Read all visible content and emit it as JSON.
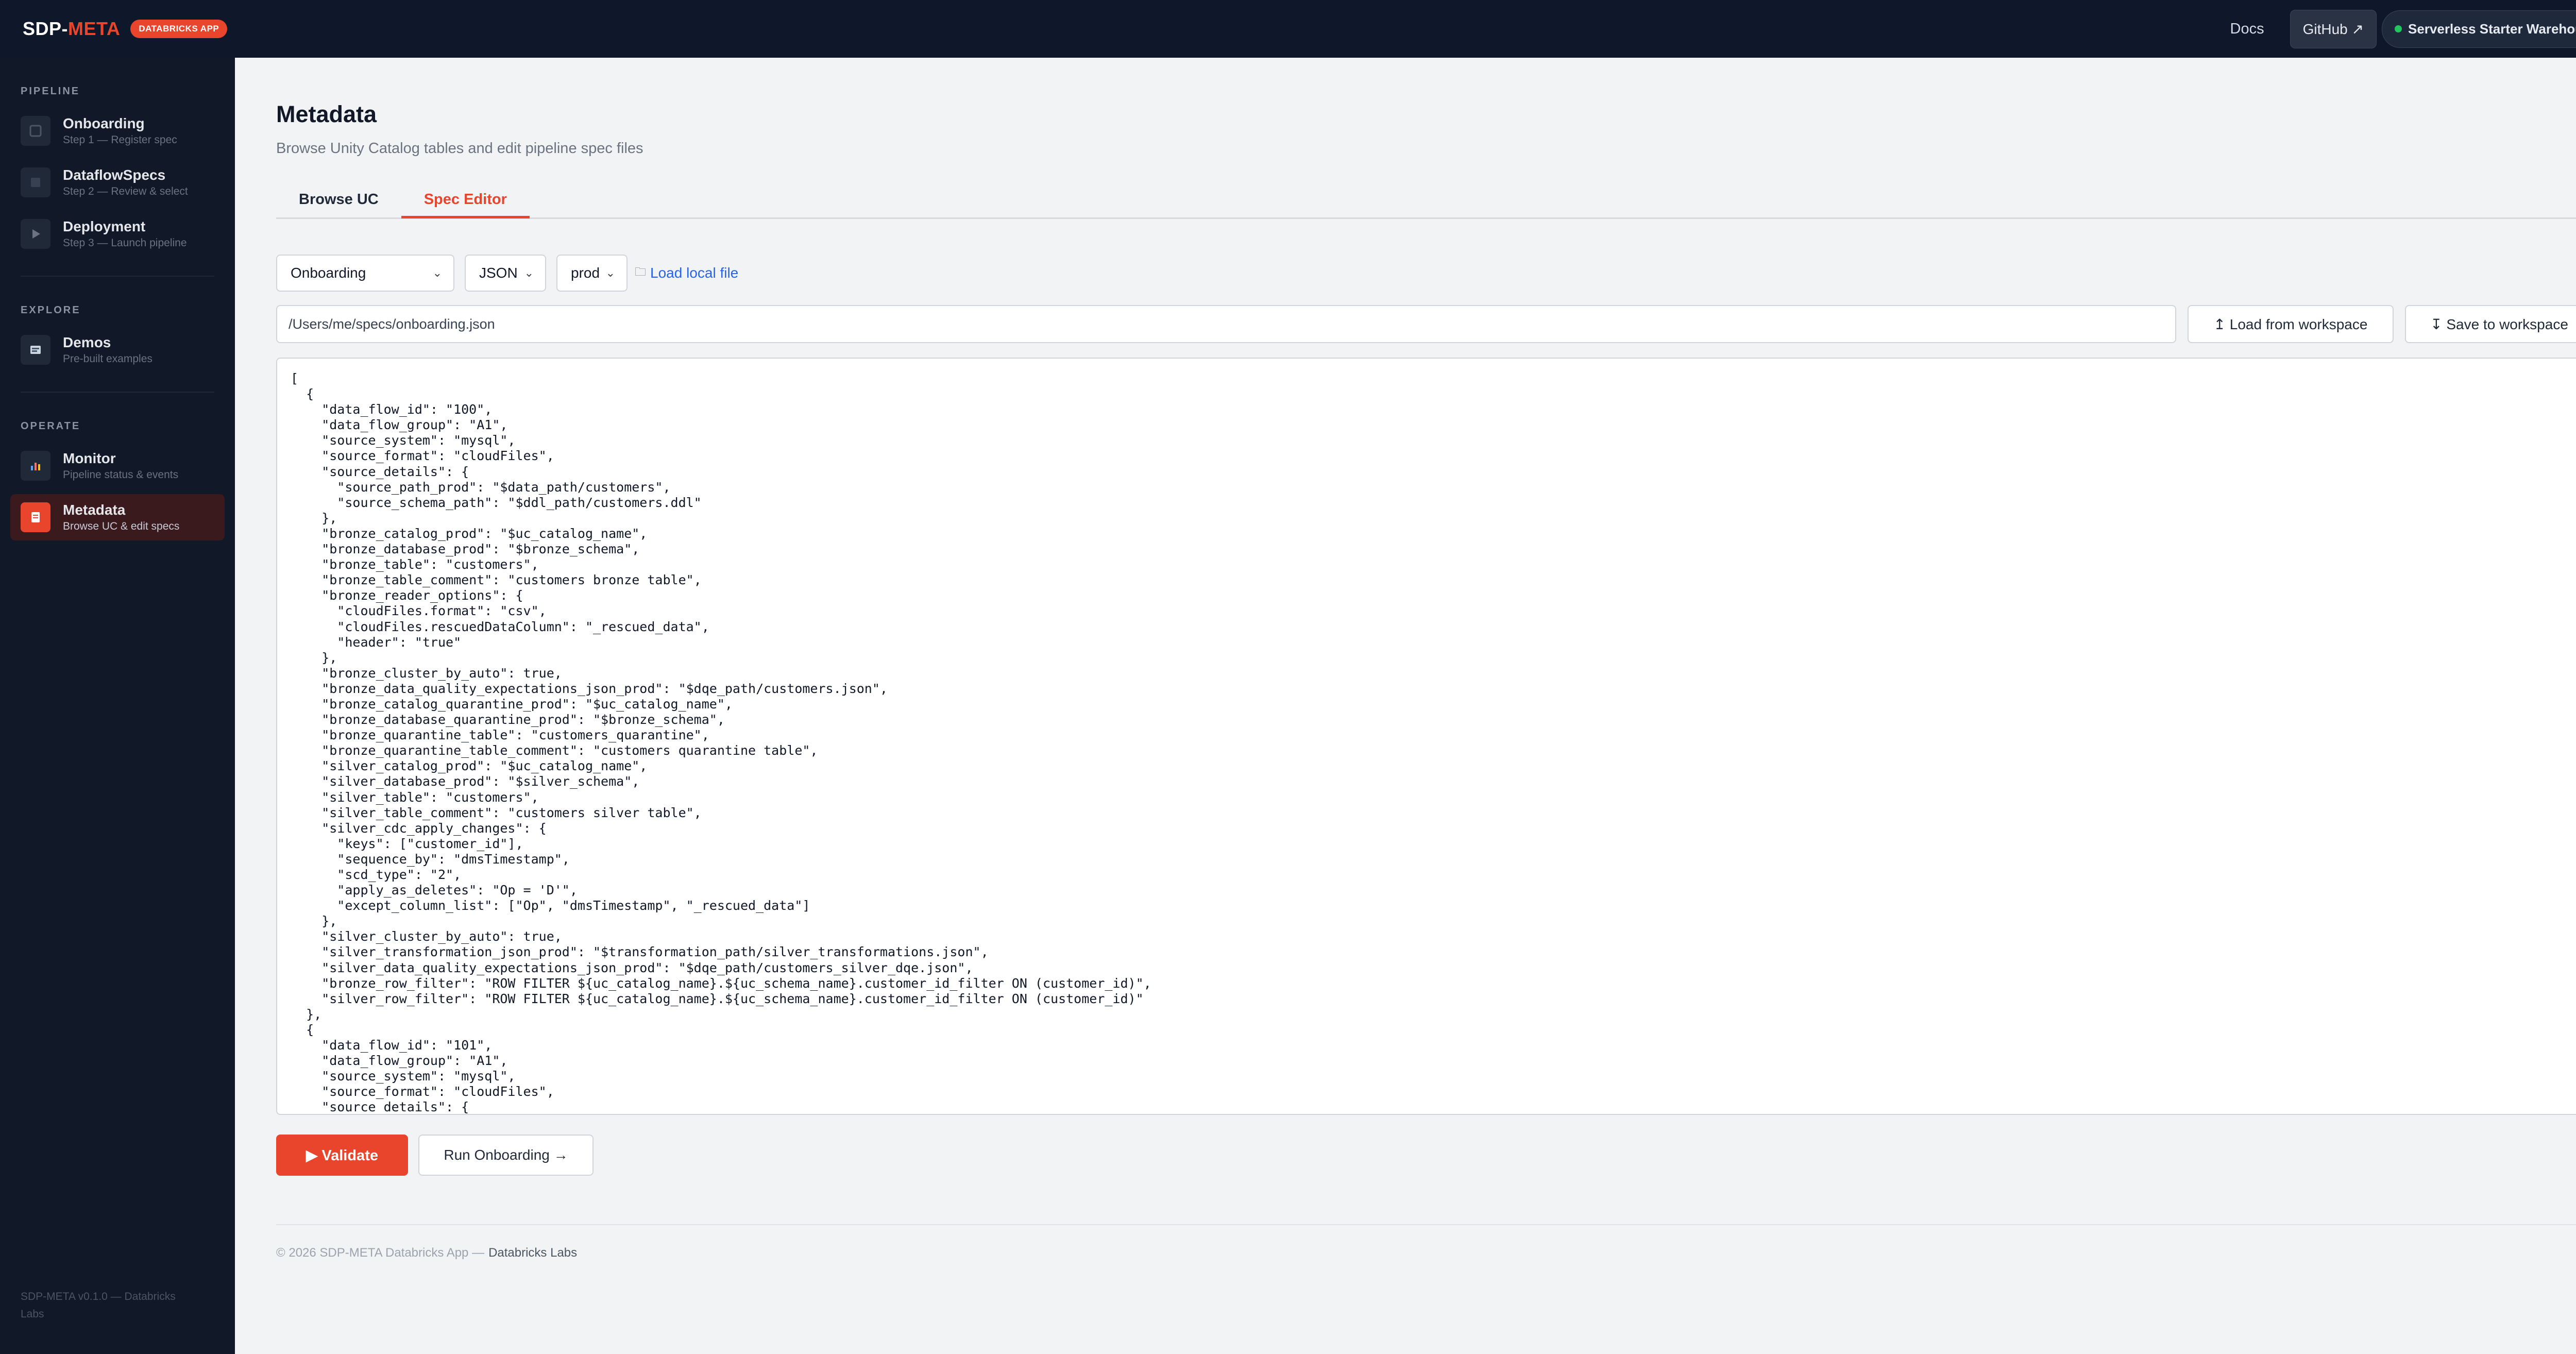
{
  "topbar": {
    "logo_a": "SDP-",
    "logo_b": "META",
    "badge": "DATABRICKS APP",
    "docs": "Docs",
    "github": "GitHub ↗",
    "warehouse": "Serverless Starter Warehouse",
    "warehouse_status_color": "#22c55e"
  },
  "sidebar": {
    "sections": {
      "pipeline": "PIPELINE",
      "explore": "EXPLORE",
      "operate": "OPERATE"
    },
    "items": [
      {
        "title": "Onboarding",
        "sub": "Step 1 — Register spec",
        "icon": "onboarding-icon"
      },
      {
        "title": "DataflowSpecs",
        "sub": "Step 2 — Review & select",
        "icon": "specs-icon"
      },
      {
        "title": "Deployment",
        "sub": "Step 3 — Launch pipeline",
        "icon": "play-icon"
      },
      {
        "title": "Demos",
        "sub": "Pre-built examples",
        "icon": "demos-icon"
      },
      {
        "title": "Monitor",
        "sub": "Pipeline status & events",
        "icon": "chart-icon"
      },
      {
        "title": "Metadata",
        "sub": "Browse UC & edit specs",
        "icon": "metadata-icon"
      }
    ],
    "footer": "SDP-META v0.1.0 — Databricks Labs"
  },
  "main": {
    "title": "Metadata",
    "subtitle": "Browse Unity Catalog tables and edit pipeline spec files",
    "tabs": [
      "Browse UC",
      "Spec Editor"
    ],
    "active_tab": "Spec Editor",
    "spec_type": "Onboarding",
    "format": "JSON",
    "env": "prod",
    "load_local": "Load local file",
    "path_value": "/Users/me/specs/onboarding.json",
    "load_workspace": "↥ Load from workspace",
    "save_workspace": "↧ Save to workspace",
    "validate": "▶ Validate",
    "run_onboarding": "Run Onboarding →",
    "footer_text": "© 2026 SDP-META Databricks App —",
    "footer_link": "Databricks Labs",
    "accent_color": "#e8452c",
    "editor_content": "[\n  {\n    \"data_flow_id\": \"100\",\n    \"data_flow_group\": \"A1\",\n    \"source_system\": \"mysql\",\n    \"source_format\": \"cloudFiles\",\n    \"source_details\": {\n      \"source_path_prod\": \"$data_path/customers\",\n      \"source_schema_path\": \"$ddl_path/customers.ddl\"\n    },\n    \"bronze_catalog_prod\": \"$uc_catalog_name\",\n    \"bronze_database_prod\": \"$bronze_schema\",\n    \"bronze_table\": \"customers\",\n    \"bronze_table_comment\": \"customers bronze table\",\n    \"bronze_reader_options\": {\n      \"cloudFiles.format\": \"csv\",\n      \"cloudFiles.rescuedDataColumn\": \"_rescued_data\",\n      \"header\": \"true\"\n    },\n    \"bronze_cluster_by_auto\": true,\n    \"bronze_data_quality_expectations_json_prod\": \"$dqe_path/customers.json\",\n    \"bronze_catalog_quarantine_prod\": \"$uc_catalog_name\",\n    \"bronze_database_quarantine_prod\": \"$bronze_schema\",\n    \"bronze_quarantine_table\": \"customers_quarantine\",\n    \"bronze_quarantine_table_comment\": \"customers quarantine table\",\n    \"silver_catalog_prod\": \"$uc_catalog_name\",\n    \"silver_database_prod\": \"$silver_schema\",\n    \"silver_table\": \"customers\",\n    \"silver_table_comment\": \"customers silver table\",\n    \"silver_cdc_apply_changes\": {\n      \"keys\": [\"customer_id\"],\n      \"sequence_by\": \"dmsTimestamp\",\n      \"scd_type\": \"2\",\n      \"apply_as_deletes\": \"Op = 'D'\",\n      \"except_column_list\": [\"Op\", \"dmsTimestamp\", \"_rescued_data\"]\n    },\n    \"silver_cluster_by_auto\": true,\n    \"silver_transformation_json_prod\": \"$transformation_path/silver_transformations.json\",\n    \"silver_data_quality_expectations_json_prod\": \"$dqe_path/customers_silver_dqe.json\",\n    \"bronze_row_filter\": \"ROW FILTER ${uc_catalog_name}.${uc_schema_name}.customer_id_filter ON (customer_id)\",\n    \"silver_row_filter\": \"ROW FILTER ${uc_catalog_name}.${uc_schema_name}.customer_id_filter ON (customer_id)\"\n  },\n  {\n    \"data_flow_id\": \"101\",\n    \"data_flow_group\": \"A1\",\n    \"source_system\": \"mysql\",\n    \"source_format\": \"cloudFiles\",\n    \"source_details\": {\n      \"source_path_prod\": \"$data_path/transactions\","
  }
}
